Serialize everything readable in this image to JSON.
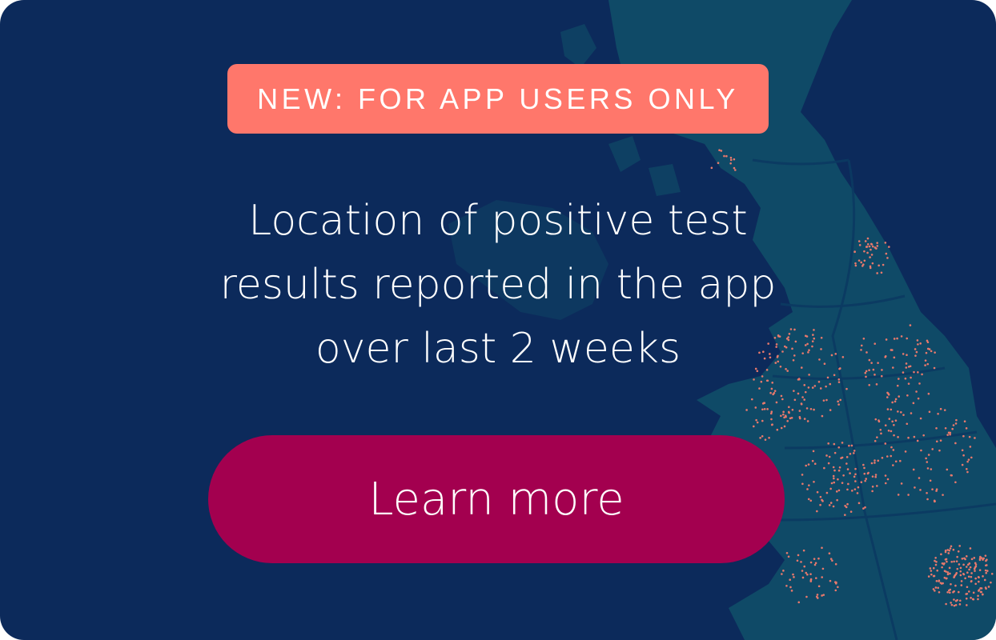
{
  "banner": {
    "badge_label": "NEW: FOR APP USERS ONLY",
    "headline_lines": [
      "Location of positive test",
      "results reported in the app",
      "over last 2 weeks"
    ],
    "cta_label": "Learn more"
  },
  "colors": {
    "background": "#0c2a5b",
    "land": "#0f4a67",
    "badge": "#ff776b",
    "cta": "#a3004f",
    "dots": "#e8796c"
  },
  "icons": [
    "uk-map-graphic"
  ]
}
